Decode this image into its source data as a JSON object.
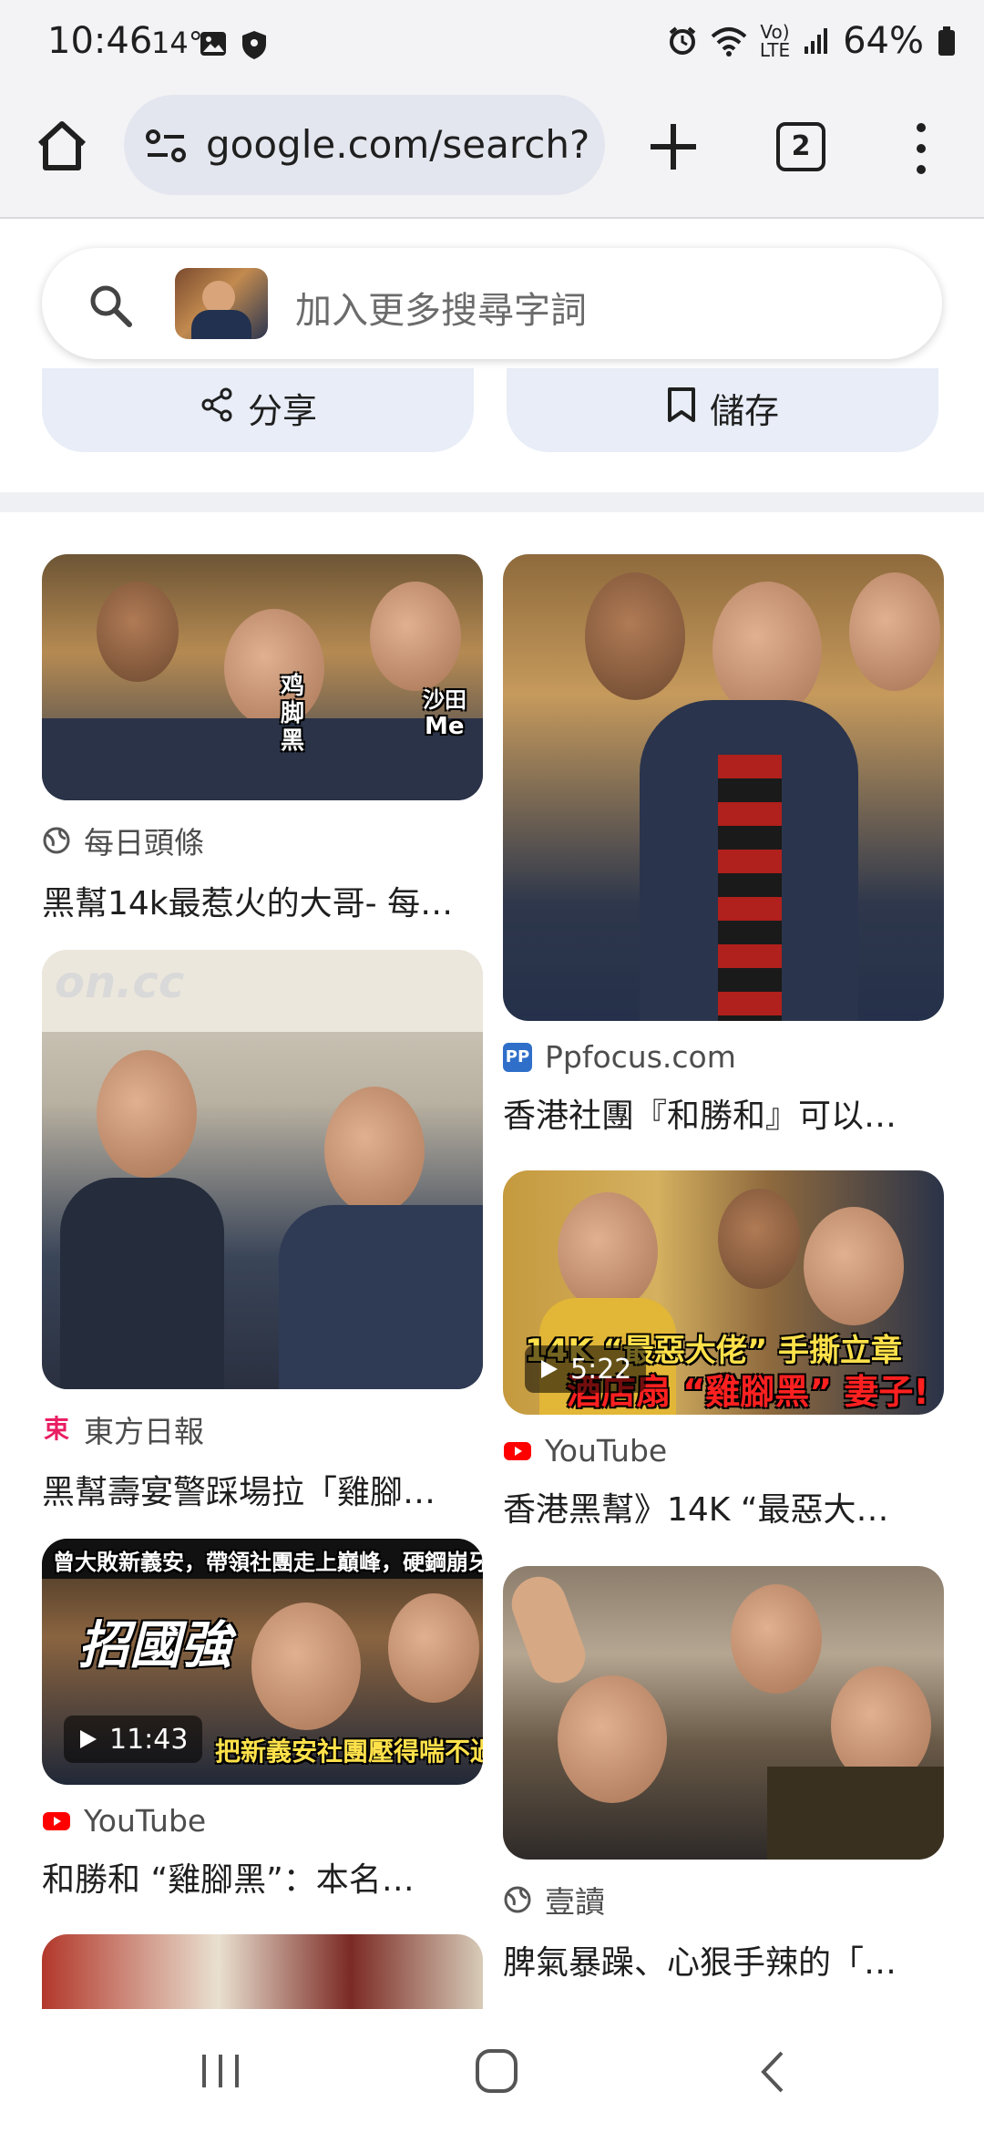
{
  "status_bar": {
    "time": "10:46",
    "temperature": "14°",
    "volte_top": "Vo)",
    "volte_bottom": "LTE",
    "battery": "64%"
  },
  "browser": {
    "url": "google.com/search?",
    "tab_count": "2"
  },
  "search": {
    "placeholder": "加入更多搜尋字詞"
  },
  "actions": {
    "share_label": "分享",
    "save_label": "儲存"
  },
  "results": {
    "left": [
      {
        "source": "每日頭條",
        "title": "黑幫14k最惹火的大哥- 每…",
        "overlay_right_top": "沙田",
        "overlay_right_bottom": "Me",
        "overlay_left": "鸡脚黑"
      },
      {
        "source": "東方日報",
        "title": "黑幫壽宴警踩場拉「雞腳…",
        "overlay_logo": "on.cc"
      },
      {
        "source": "YouTube",
        "title": "和勝和 “雞腳黑”：本名…",
        "duration": "11:43",
        "overlay_top": "曾大敗新義安，帶領社團走上巔峰，硬鋼崩牙駒",
        "overlay_mid": "招國強",
        "overlay_bottom": "把新義安社團壓得喘不過氣來"
      }
    ],
    "right": [
      {
        "source": "Ppfocus.com",
        "title": "香港社團『和勝和』可以…"
      },
      {
        "source": "YouTube",
        "title": "香港黑幫》14K “最惡大…",
        "duration": "5:22",
        "overlay_top": "14K “最惡大佬” 手撕立章",
        "overlay_bottom": "酒店扇 “雞腳黑” 妻子!"
      },
      {
        "source": "壹讀",
        "title": "脾氣暴躁、心狠手辣的「…"
      }
    ]
  },
  "colors": {
    "youtube_red": "#ff0000",
    "oncc_pink": "#e91e63",
    "ppfocus_blue": "#2f6fc9",
    "pill_bg": "#e8edf7"
  }
}
